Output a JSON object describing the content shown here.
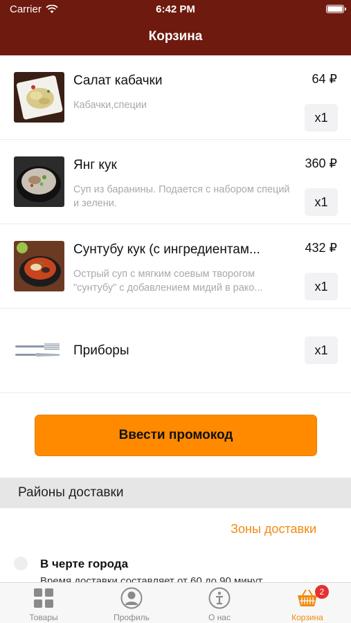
{
  "status_bar": {
    "carrier": "Carrier",
    "time": "6:42 PM"
  },
  "nav": {
    "title": "Корзина"
  },
  "cart": {
    "items": [
      {
        "name": "Салат кабачки",
        "description": "Кабачки,специи",
        "price": "64 ₽",
        "quantity": "x1",
        "image": "salad-photo"
      },
      {
        "name": "Янг кук",
        "description": "Суп из баранины. Подается с набором специй и зелени.",
        "price": "360 ₽",
        "quantity": "x1",
        "image": "soup-photo"
      },
      {
        "name": "Сунтубу кук (с ингредиентам...",
        "description": "Острый суп с мягким соевым творогом \"сунтубу\" с добавлением мидий в рако...",
        "price": "432 ₽",
        "quantity": "x1",
        "image": "spicy-soup-photo"
      },
      {
        "name": "Приборы",
        "description": "",
        "price": "",
        "quantity": "x1",
        "image": "cutlery-icon"
      }
    ],
    "promo_button": "Ввести промокод"
  },
  "delivery": {
    "section_title": "Районы доставки",
    "zones_link": "Зоны доставки",
    "option_title": "В черте города",
    "option_description": "Время доставки составляет от 60 до 90 минут"
  },
  "tabbar": {
    "tabs": [
      {
        "label": "Товары",
        "icon": "grid-icon",
        "active": false
      },
      {
        "label": "Профиль",
        "icon": "profile-icon",
        "active": false
      },
      {
        "label": "О нас",
        "icon": "info-icon",
        "active": false
      },
      {
        "label": "Корзина",
        "icon": "basket-icon",
        "active": true,
        "badge": "2"
      }
    ]
  },
  "colors": {
    "header": "#6e1a0e",
    "accent": "#ff8a00",
    "link": "#f08a12",
    "badge": "#e53030"
  }
}
